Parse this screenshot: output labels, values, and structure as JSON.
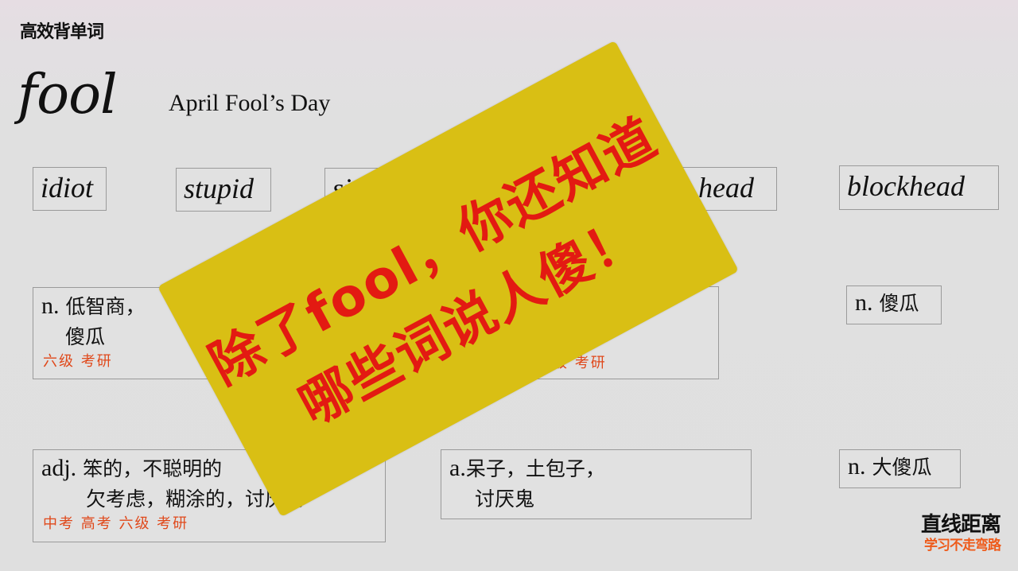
{
  "header": {
    "brand": "高效背单词",
    "headword": "fool",
    "phrase": "April Fool’s Day"
  },
  "synonyms": [
    {
      "word": "idiot"
    },
    {
      "word": "stupid"
    },
    {
      "word": "si",
      "note": "partially hidden by card"
    },
    {
      "word": "head",
      "note": "partially hidden by card"
    },
    {
      "word": "blockhead"
    }
  ],
  "definitions": {
    "idiot": {
      "pos": "n.",
      "line1": "低智商，",
      "line2": "傻瓜",
      "tags": "六级 考研"
    },
    "middle": {
      "tags_visible": "级 考研"
    },
    "blockhead": {
      "pos": "n.",
      "line1": "傻瓜"
    },
    "stupid": {
      "pos": "adj.",
      "line1": "笨的，不聪明的",
      "line2": "欠考虑，糊涂的，讨厌的",
      "tags": "中考 高考 六级 考研"
    },
    "bottom_middle": {
      "pos": "a.",
      "line1": "呆子，土包子，",
      "line2": "讨厌鬼"
    },
    "bottom_right": {
      "pos": "n.",
      "line1": "大傻瓜"
    }
  },
  "overlay_card": {
    "line1": "除了fool，你还知道",
    "line2": "哪些词说人傻！",
    "colors": {
      "background": "#d9bf14",
      "text": "#e31a12"
    }
  },
  "footer_brand": {
    "title": "直线距离",
    "slogan": "学习不走弯路"
  }
}
